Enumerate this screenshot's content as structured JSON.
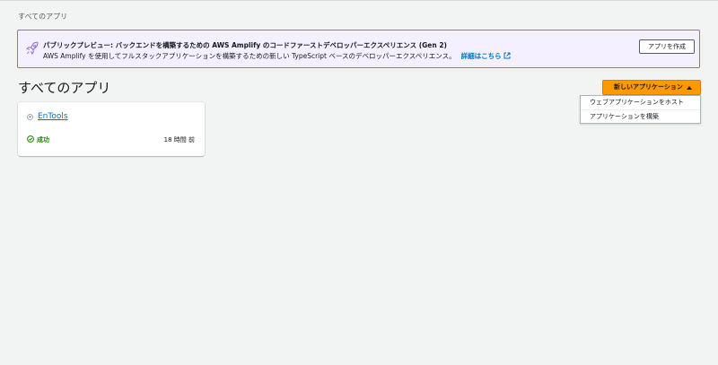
{
  "breadcrumb": "すべてのアプリ",
  "banner": {
    "title": "パブリックプレビュー: バックエンドを構築するための AWS Amplify のコードファーストデベロッパーエクスペリエンス (Gen 2)",
    "description": "AWS Amplify を使用してフルスタックアプリケーションを構築するための新しい TypeScript ベースのデベロッパーエクスペリエンス。",
    "link_label": "詳細はこちら",
    "create_button": "アプリを作成",
    "icon": "rocket-icon",
    "accent_color": "#8d6ce0"
  },
  "page_title": "すべてのアプリ",
  "new_app": {
    "button_label": "新しいアプリケーション",
    "accent_color": "#ff9900",
    "menu": [
      "ウェブアプリケーションをホスト",
      "アプリケーションを構築"
    ]
  },
  "apps": [
    {
      "name": "EnTools",
      "repo_icon": "github-icon",
      "status": "成功",
      "status_color": "#1d8102",
      "updated": "18 時間 前"
    }
  ]
}
